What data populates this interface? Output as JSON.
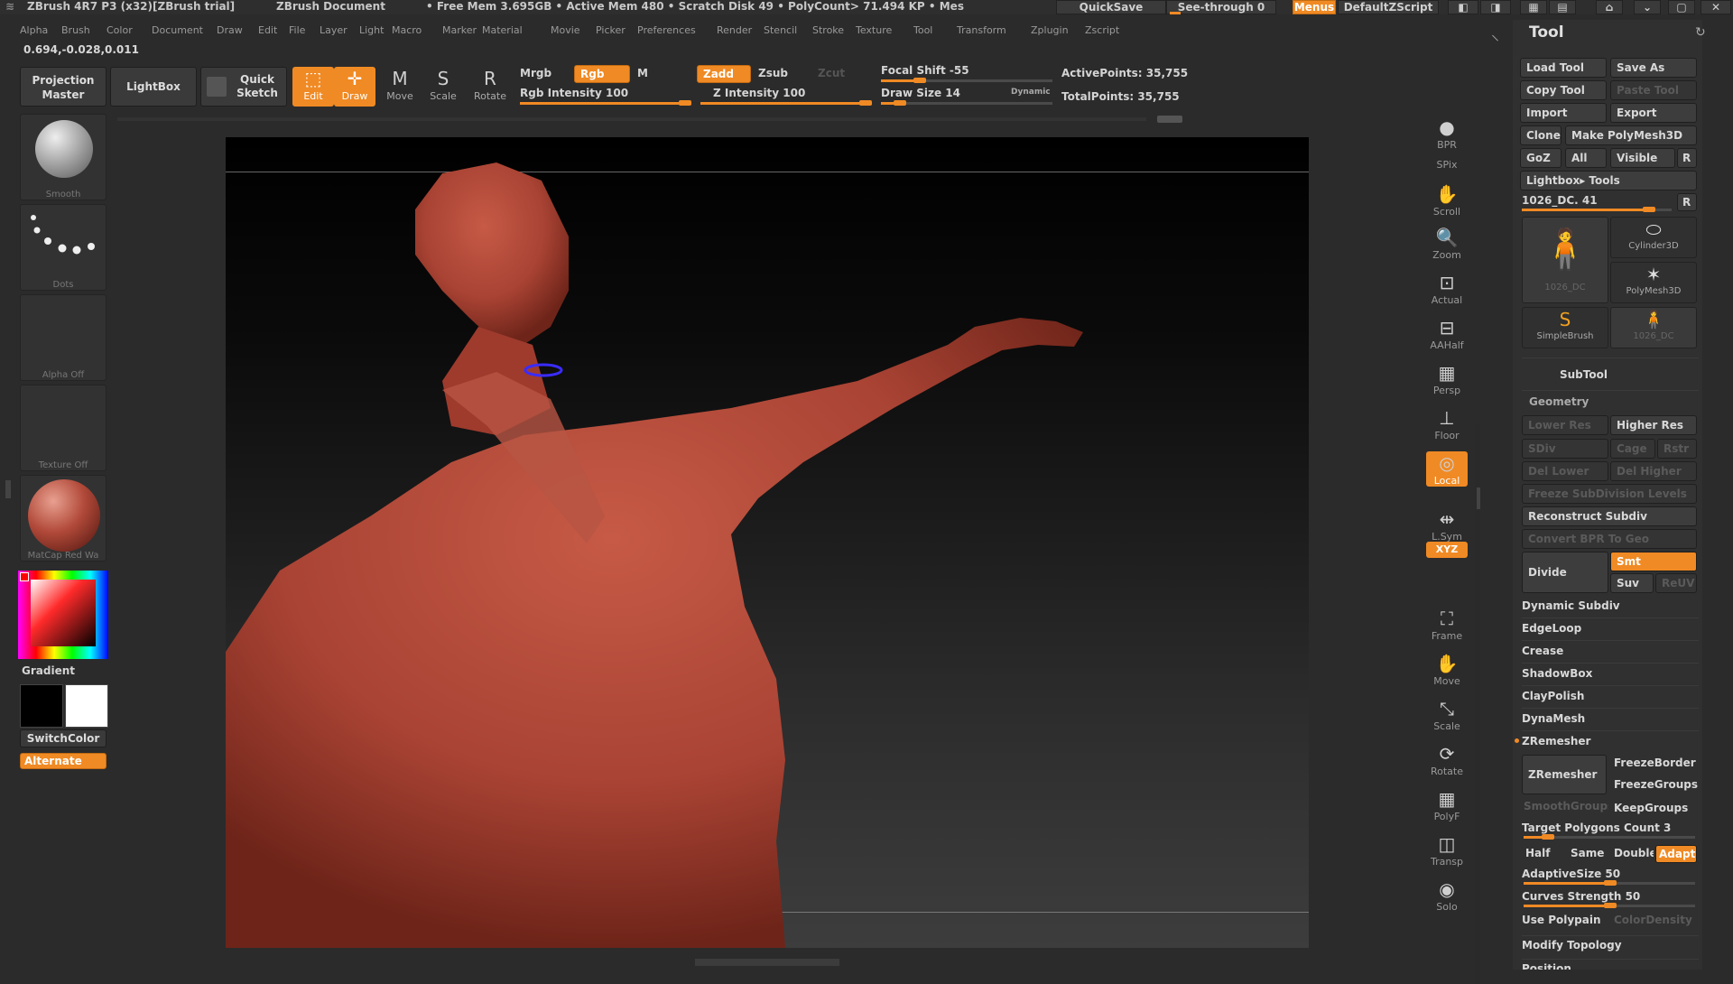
{
  "titlebar": {
    "app": "ZBrush 4R7 P3 (x32)[ZBrush trial]",
    "document": "ZBrush Document",
    "stats": "• Free Mem 3.695GB • Active Mem 480 • Scratch Disk 49 • PolyCount> 71.494 KP • Mes",
    "quicksave": "QuickSave",
    "see_through": "See-through  0",
    "menus": "Menus",
    "script": "DefaultZScript"
  },
  "menubar": {
    "items": [
      "Alpha",
      "Brush",
      "Color",
      "Document",
      "Draw",
      "Edit",
      "File",
      "Layer",
      "Light",
      "Macro",
      "Marker",
      "Material",
      "Movie",
      "Picker",
      "Preferences",
      "Render",
      "Stencil",
      "Stroke",
      "Texture",
      "Tool",
      "Transform",
      "Zplugin",
      "Zscript"
    ]
  },
  "coords": "0.694,-0.028,0.011",
  "toolbar": {
    "projection_master": "Projection Master",
    "lightbox": "LightBox",
    "quick_sketch": "Quick Sketch",
    "edit": "Edit",
    "draw": "Draw",
    "move": "Move",
    "scale": "Scale",
    "rotate": "Rotate",
    "mrgb": "Mrgb",
    "rgb": "Rgb",
    "m": "M",
    "zadd": "Zadd",
    "zsub": "Zsub",
    "zcut": "Zcut",
    "rgb_intensity": "Rgb Intensity 100",
    "z_intensity": "Z Intensity 100",
    "focal_shift": "Focal Shift -55",
    "draw_size": "Draw Size 14",
    "dynamic": "Dynamic",
    "active_points": "ActivePoints: 35,755",
    "total_points": "TotalPoints: 35,755"
  },
  "leftshelf": {
    "brush_label": "Smooth",
    "stroke_label": "Dots",
    "alpha_label": "Alpha  Off",
    "texture_label": "Texture  Off",
    "material_label": "MatCap Red Wa",
    "gradient": "Gradient",
    "switchcolor": "SwitchColor",
    "alternate": "Alternate"
  },
  "rightshelf": [
    {
      "name": "bpr",
      "label": "BPR"
    },
    {
      "name": "spix",
      "label": "SPix"
    },
    {
      "name": "scroll",
      "label": "Scroll"
    },
    {
      "name": "zoom",
      "label": "Zoom"
    },
    {
      "name": "actual",
      "label": "Actual"
    },
    {
      "name": "aahalf",
      "label": "AAHalf"
    },
    {
      "name": "persp",
      "label": "Persp"
    },
    {
      "name": "floor",
      "label": "Floor"
    },
    {
      "name": "local",
      "label": "Local"
    },
    {
      "name": "lsym",
      "label": "L.Sym"
    },
    {
      "name": "xyz",
      "label": "XYZ"
    },
    {
      "name": "frame",
      "label": "Frame"
    },
    {
      "name": "move",
      "label": "Move"
    },
    {
      "name": "scale",
      "label": "Scale"
    },
    {
      "name": "rotate",
      "label": "Rotate"
    },
    {
      "name": "polyf",
      "label": "PolyF"
    },
    {
      "name": "transp",
      "label": "Transp"
    },
    {
      "name": "solo",
      "label": "Solo"
    }
  ],
  "panel": {
    "title": "Tool",
    "load_tool": "Load Tool",
    "save_as": "Save As",
    "copy_tool": "Copy Tool",
    "paste_tool": "Paste Tool",
    "import": "Import",
    "export": "Export",
    "clone": "Clone",
    "make_polymesh": "Make PolyMesh3D",
    "goz": "GoZ",
    "all": "All",
    "visible": "Visible",
    "r": "R",
    "lightbox_tools": "Lightbox▸ Tools",
    "current_tool": "1026_DC. 41",
    "thumbs": [
      {
        "name": "1026-dc",
        "label": "1026_DC"
      },
      {
        "name": "cylinder3d",
        "label": "Cylinder3D"
      },
      {
        "name": "polymesh3d",
        "label": "PolyMesh3D"
      },
      {
        "name": "simplebrush",
        "label": "SimpleBrush"
      },
      {
        "name": "1026-dc-2",
        "label": "1026_DC"
      }
    ],
    "subtool": "SubTool",
    "geometry": "Geometry",
    "lower_res": "Lower Res",
    "higher_res": "Higher Res",
    "sdiv": "SDiv",
    "cage": "Cage",
    "rstr": "Rstr",
    "del_lower": "Del Lower",
    "del_higher": "Del Higher",
    "freeze_subdiv": "Freeze SubDivision Levels",
    "reconstruct_subdiv": "Reconstruct Subdiv",
    "convert_bpr": "Convert BPR To Geo",
    "divide": "Divide",
    "smt": "Smt",
    "suv": "Suv",
    "reuv": "ReUV",
    "dynamic_subdiv": "Dynamic Subdiv",
    "edgeloop": "EdgeLoop",
    "crease": "Crease",
    "shadowbox": "ShadowBox",
    "claypolish": "ClayPolish",
    "dynamesh": "DynaMesh",
    "zremesher_section": "ZRemesher",
    "zremesher_btn": "ZRemesher",
    "freezeborder": "FreezeBorder",
    "freezegroups": "FreezeGroups",
    "smoothgroups": "SmoothGroups",
    "keepgroups": "KeepGroups",
    "target_polygons": "Target Polygons Count 3",
    "half": "Half",
    "same": "Same",
    "double": "Double",
    "adapt": "Adapt",
    "adaptive_size": "AdaptiveSize 50",
    "curves_strength": "Curves Strength 50",
    "use_polypaint": "Use Polypain",
    "color_density": "ColorDensity",
    "modify_topology": "Modify Topology",
    "position": "Position"
  },
  "colors": {
    "accent": "#f08a24",
    "model": "#b24a3a",
    "panel_bg": "#303030"
  }
}
